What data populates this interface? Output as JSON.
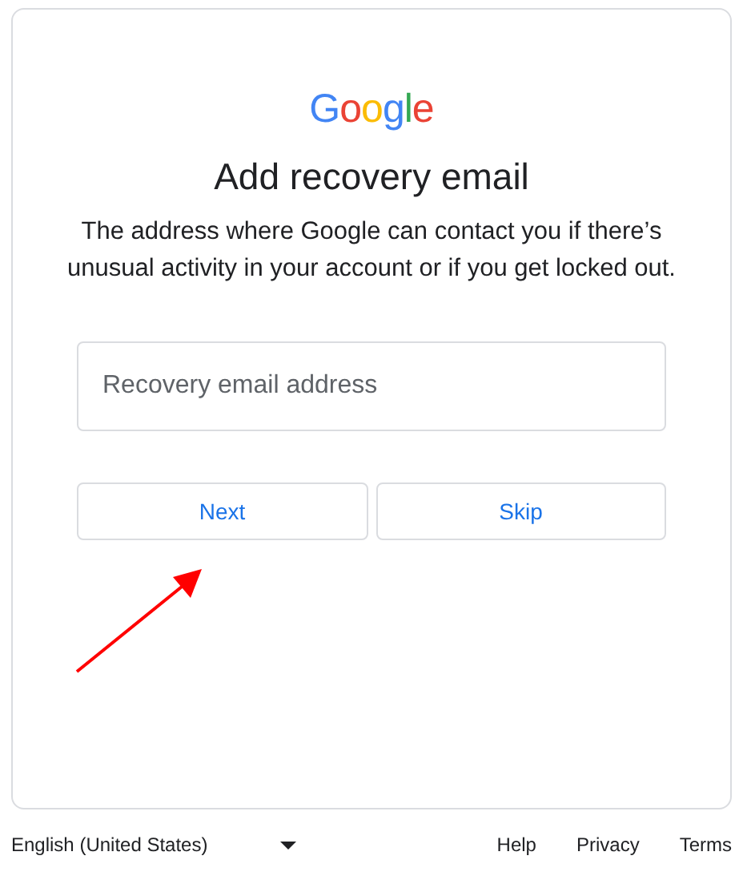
{
  "logo": "Google",
  "title": "Add recovery email",
  "description": "The address where Google can contact you if there’s unusual activity in your account or if you get locked out.",
  "email_field": {
    "placeholder": "Recovery email address"
  },
  "buttons": [
    {
      "label": "Next"
    },
    {
      "label": "Skip"
    }
  ],
  "footer": {
    "language": "English (United States)",
    "links": [
      "Help",
      "Privacy",
      "Terms"
    ]
  }
}
